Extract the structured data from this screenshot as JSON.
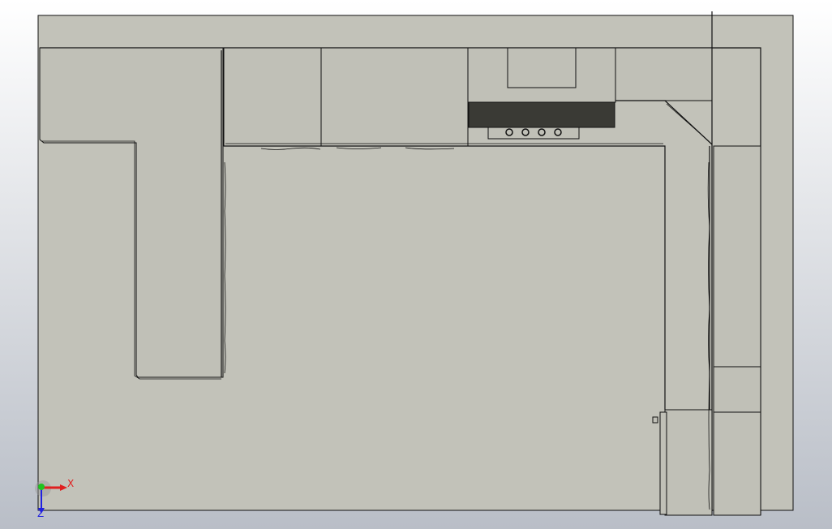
{
  "viewport": {
    "background_top": "#ffffff",
    "background_bottom": "#b9bec7"
  },
  "model": {
    "floor_color": "#c2c2b9",
    "surface_color": "#c0c0b7",
    "line_color": "#111111",
    "hob_color": "#3a3a35",
    "burner_count": 4
  },
  "triad": {
    "x_label": "X",
    "z_label": "Z",
    "x_color": "#e02020",
    "y_color": "#1ec31e",
    "z_color": "#2020e0"
  }
}
